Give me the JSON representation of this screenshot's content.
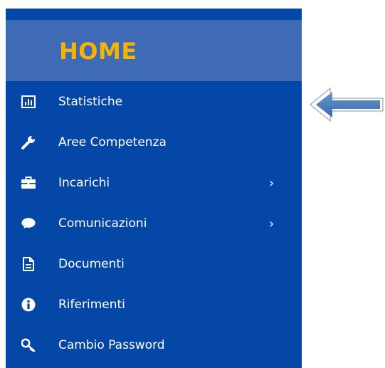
{
  "header": {
    "title": "HOME"
  },
  "menu": {
    "items": [
      {
        "label": "Statistiche",
        "icon": "bar-chart-icon"
      },
      {
        "label": "Aree Competenza",
        "icon": "wrench-icon"
      },
      {
        "label": "Incarichi",
        "icon": "briefcase-icon",
        "chevron": "›"
      },
      {
        "label": "Comunicazioni",
        "icon": "speech-bubble-icon",
        "chevron": "›"
      },
      {
        "label": "Documenti",
        "icon": "document-icon"
      },
      {
        "label": "Riferimenti",
        "icon": "info-icon"
      },
      {
        "label": "Cambio Password",
        "icon": "key-icon"
      }
    ]
  },
  "colors": {
    "sidebar": "#0447a6",
    "header": "#3f6bb6",
    "title": "#f6b400",
    "arrow": "#4f81bd"
  }
}
